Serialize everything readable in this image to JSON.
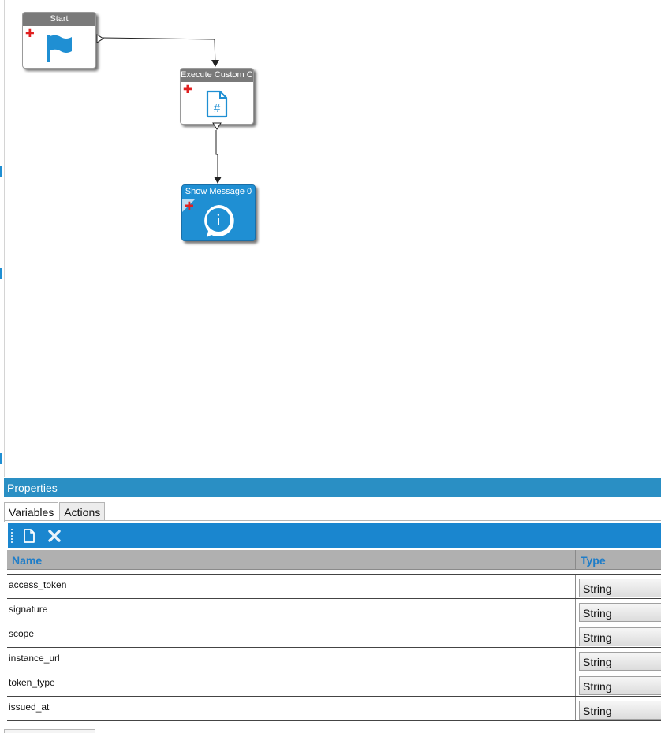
{
  "canvas": {
    "nodes": [
      {
        "title": "Start",
        "icon": "flag-icon"
      },
      {
        "title": "Execute Custom Code",
        "icon": "code-file-icon"
      },
      {
        "title": "Show Message 0",
        "icon": "info-message-icon"
      }
    ],
    "add_symbol": "✚"
  },
  "properties": {
    "title": "Properties",
    "tabs": [
      {
        "label": "Variables",
        "active": true
      },
      {
        "label": "Actions",
        "active": false
      }
    ],
    "toolbar": {
      "new_icon": "new-document-icon",
      "delete_icon": "delete-x-icon"
    },
    "columns": {
      "name": "Name",
      "type": "Type"
    },
    "rows": [
      {
        "name": "access_token",
        "type": "String"
      },
      {
        "name": "signature",
        "type": "String"
      },
      {
        "name": "scope",
        "type": "String"
      },
      {
        "name": "instance_url",
        "type": "String"
      },
      {
        "name": "token_type",
        "type": "String"
      },
      {
        "name": "issued_at",
        "type": "String"
      }
    ]
  },
  "colors": {
    "accent": "#1f8fd3",
    "panel_header": "#2a8fc4",
    "toolbar": "#1a86cf",
    "add_red": "#e02020"
  }
}
